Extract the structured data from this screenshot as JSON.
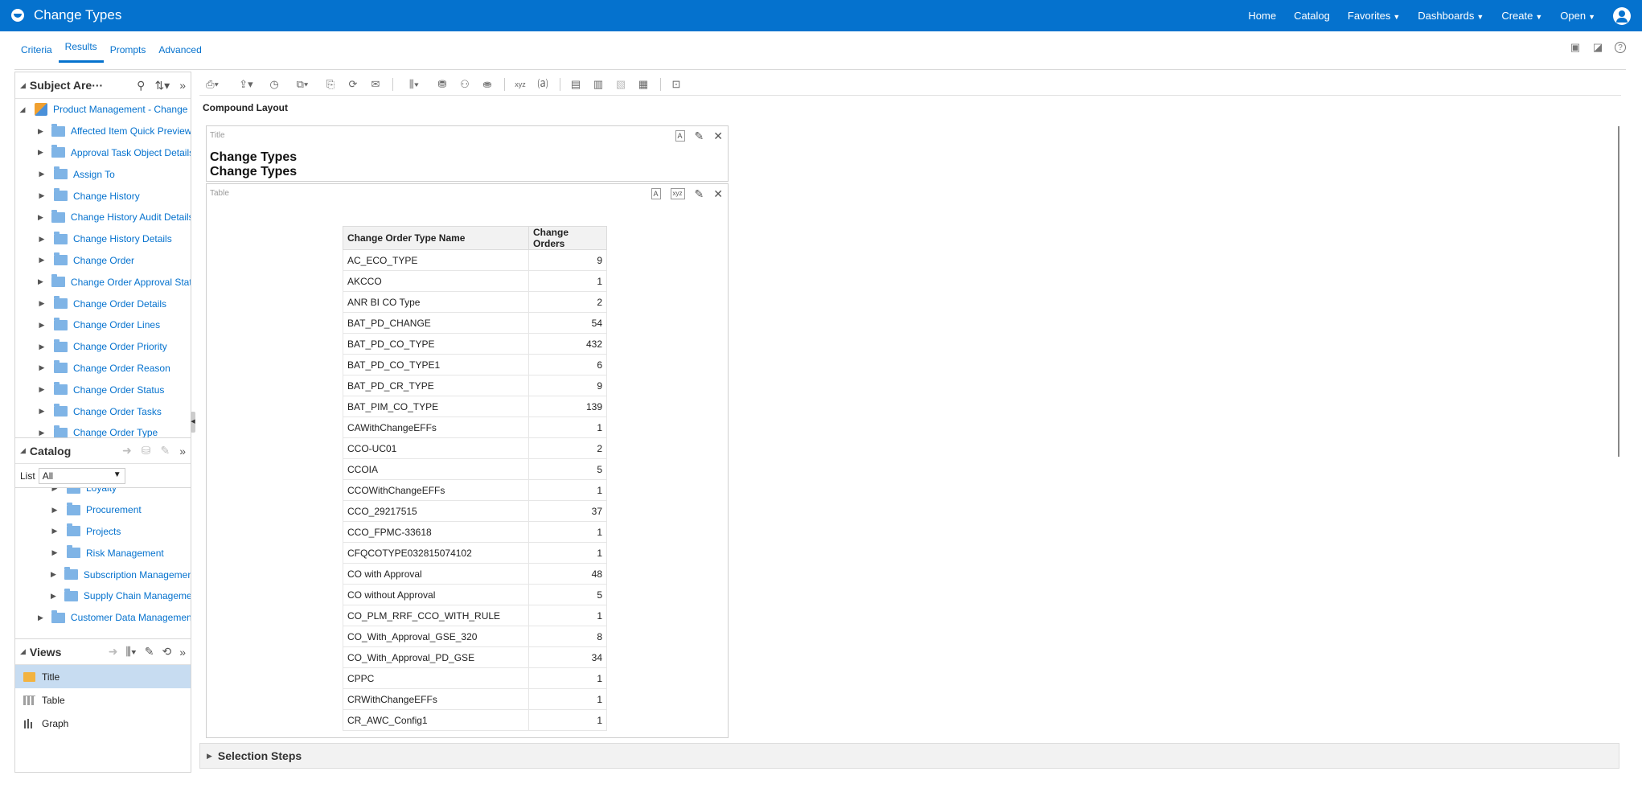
{
  "header": {
    "title": "Change Types",
    "nav": [
      {
        "label": "Home",
        "dropdown": false
      },
      {
        "label": "Catalog",
        "dropdown": false
      },
      {
        "label": "Favorites",
        "dropdown": true
      },
      {
        "label": "Dashboards",
        "dropdown": true
      },
      {
        "label": "Create",
        "dropdown": true
      },
      {
        "label": "Open",
        "dropdown": true
      }
    ],
    "colors": {
      "bar": "#0572ce"
    }
  },
  "tabs": [
    {
      "label": "Criteria",
      "active": false
    },
    {
      "label": "Results",
      "active": true
    },
    {
      "label": "Prompts",
      "active": false
    },
    {
      "label": "Advanced",
      "active": false
    }
  ],
  "subject_areas": {
    "title": "Subject Are···",
    "root": "Product Management - Change",
    "items": [
      "Affected Item Quick Preview",
      "Approval Task Object Details",
      "Assign To",
      "Change History",
      "Change History Audit Details",
      "Change History Details",
      "Change Order",
      "Change Order Approval Status",
      "Change Order Details",
      "Change Order Lines",
      "Change Order Priority",
      "Change Order Reason",
      "Change Order Status",
      "Change Order Tasks",
      "Change Order Type"
    ]
  },
  "catalog": {
    "title": "Catalog",
    "list_label": "List",
    "list_value": "All",
    "items": [
      {
        "label": "Loyalty",
        "level": 2
      },
      {
        "label": "Procurement",
        "level": 2
      },
      {
        "label": "Projects",
        "level": 2
      },
      {
        "label": "Risk Management",
        "level": 2
      },
      {
        "label": "Subscription Management",
        "level": 2
      },
      {
        "label": "Supply Chain Management",
        "level": 2
      },
      {
        "label": "Customer Data Management",
        "level": 1
      }
    ]
  },
  "views": {
    "title": "Views",
    "items": [
      {
        "label": "Title",
        "selected": true,
        "icon": "title-icon"
      },
      {
        "label": "Table",
        "selected": false,
        "icon": "table-icon"
      },
      {
        "label": "Graph",
        "selected": false,
        "icon": "graph-icon"
      }
    ]
  },
  "compound_layout": {
    "label": "Compound Layout",
    "title_view": {
      "label": "Title",
      "line1": "Change Types",
      "line2": "Change Types"
    },
    "table_view": {
      "label": "Table"
    }
  },
  "table": {
    "columns": [
      "Change Order Type Name",
      "Change Orders"
    ],
    "rows": [
      [
        "AC_ECO_TYPE",
        "9"
      ],
      [
        "AKCCO",
        "1"
      ],
      [
        "ANR BI CO Type",
        "2"
      ],
      [
        "BAT_PD_CHANGE",
        "54"
      ],
      [
        "BAT_PD_CO_TYPE",
        "432"
      ],
      [
        "BAT_PD_CO_TYPE1",
        "6"
      ],
      [
        "BAT_PD_CR_TYPE",
        "9"
      ],
      [
        "BAT_PIM_CO_TYPE",
        "139"
      ],
      [
        "CAWithChangeEFFs",
        "1"
      ],
      [
        "CCO-UC01",
        "2"
      ],
      [
        "CCOIA",
        "5"
      ],
      [
        "CCOWithChangeEFFs",
        "1"
      ],
      [
        "CCO_29217515",
        "37"
      ],
      [
        "CCO_FPMC-33618",
        "1"
      ],
      [
        "CFQCOTYPE032815074102",
        "1"
      ],
      [
        "CO with Approval",
        "48"
      ],
      [
        "CO without Approval",
        "5"
      ],
      [
        "CO_PLM_RRF_CCO_WITH_RULE",
        "1"
      ],
      [
        "CO_With_Approval_GSE_320",
        "8"
      ],
      [
        "CO_With_Approval_PD_GSE",
        "34"
      ],
      [
        "CPPC",
        "1"
      ],
      [
        "CRWithChangeEFFs",
        "1"
      ],
      [
        "CR_AWC_Config1",
        "1"
      ]
    ]
  },
  "selection_steps": {
    "label": "Selection Steps"
  }
}
